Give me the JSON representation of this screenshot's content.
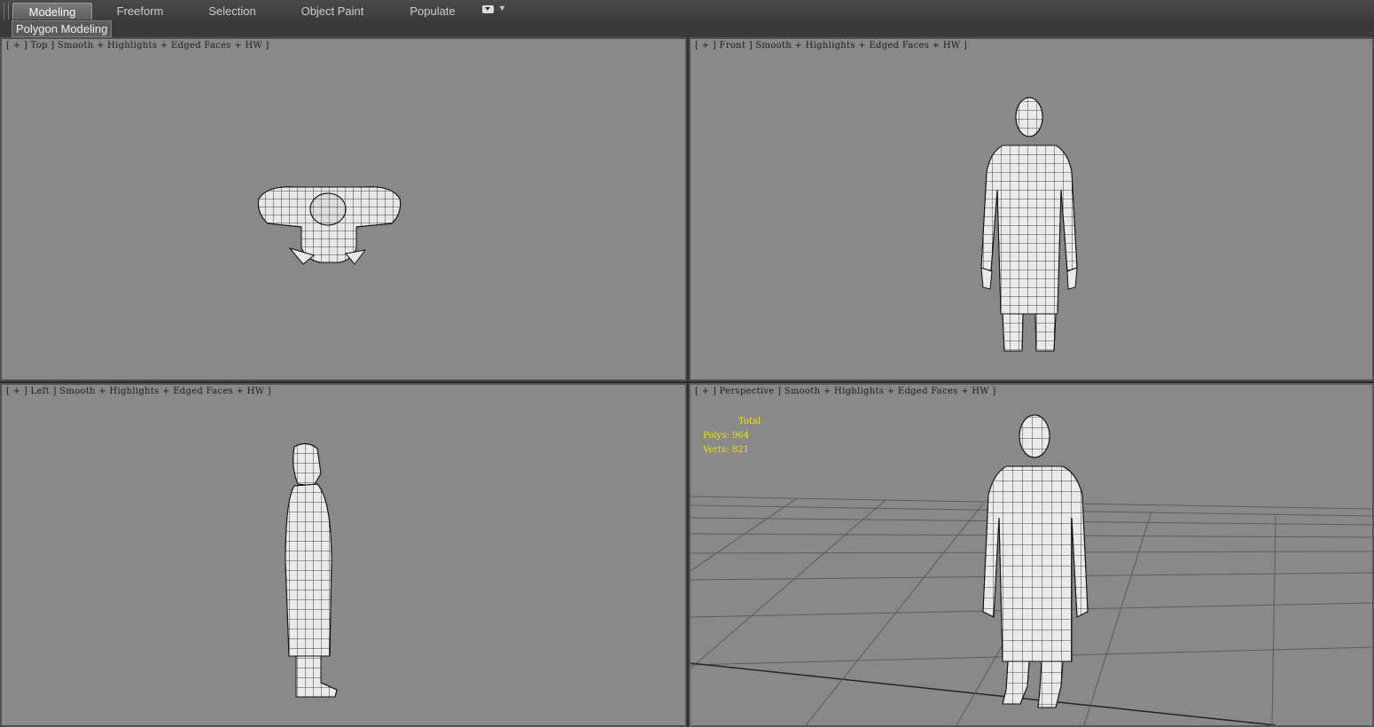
{
  "ribbon": {
    "tabs": [
      {
        "label": "Modeling",
        "active": true
      },
      {
        "label": "Freeform",
        "active": false
      },
      {
        "label": "Selection",
        "active": false
      },
      {
        "label": "Object Paint",
        "active": false
      },
      {
        "label": "Populate",
        "active": false
      }
    ],
    "panel_title": "Polygon Modeling"
  },
  "viewports": {
    "top": {
      "label": "[ + ] Top ] Smooth + Highlights + Edged Faces + HW ]"
    },
    "front": {
      "label": "[ + ] Front ] Smooth + Highlights + Edged Faces + HW ]"
    },
    "left": {
      "label": "[ + ] Left ] Smooth + Highlights + Edged Faces + HW ]"
    },
    "perspective": {
      "label": "[ + ] Perspective ] Smooth + Highlights + Edged Faces + HW ]",
      "stats": {
        "total_label": "Total",
        "polys_label": "Polys:",
        "polys": "964",
        "verts_label": "Verts:",
        "verts": "821"
      }
    }
  },
  "colors": {
    "viewport_bg": "#898989",
    "stats_text": "#f2e600",
    "mesh_fill": "#ececec",
    "mesh_edge": "#111111"
  }
}
